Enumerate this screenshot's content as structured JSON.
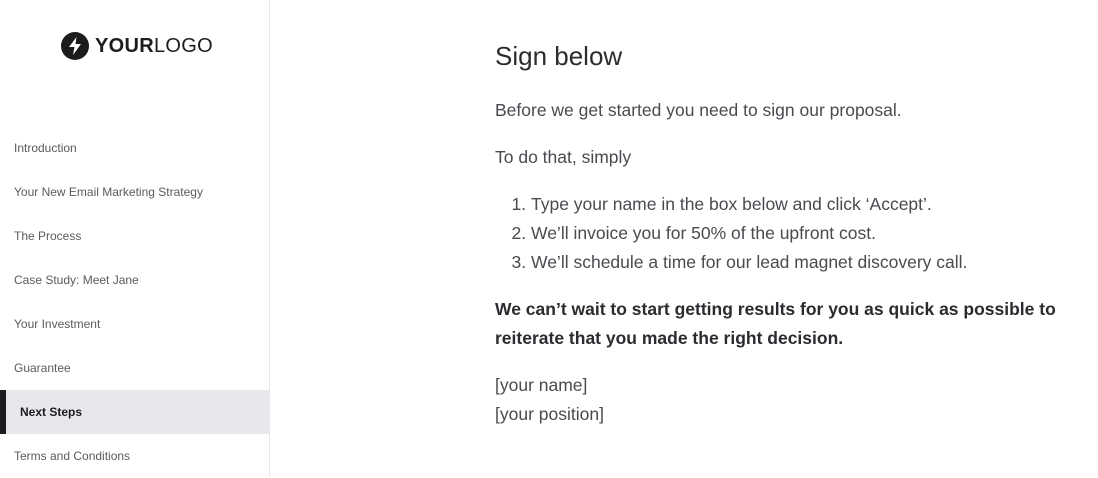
{
  "logo": {
    "icon": "lightning-bolt-icon",
    "text_bold": "YOUR",
    "text_light": "LOGO"
  },
  "sidebar": {
    "items": [
      {
        "label": "Introduction",
        "active": false
      },
      {
        "label": "Your New Email Marketing Strategy",
        "active": false
      },
      {
        "label": "The Process",
        "active": false
      },
      {
        "label": "Case Study: Meet Jane",
        "active": false
      },
      {
        "label": "Your Investment",
        "active": false
      },
      {
        "label": "Guarantee",
        "active": false
      },
      {
        "label": "Next Steps",
        "active": true
      },
      {
        "label": "Terms and Conditions",
        "active": false
      }
    ]
  },
  "main": {
    "heading": "Sign below",
    "intro": "Before we get started you need to sign our proposal.",
    "lead": "To do that, simply",
    "steps": [
      "Type your name in the box below and click ‘Accept’.",
      "We’ll invoice you for 50% of the upfront cost.",
      "We’ll schedule a time for our lead magnet discovery call."
    ],
    "closing": "We can’t wait to start getting results for you as quick as possible to reiterate that you made the right decision.",
    "signature_name": "[your name]",
    "signature_position": "[your position]"
  },
  "colors": {
    "active_bg": "#e6e8ee",
    "active_bar": "#1c1c1f",
    "text": "#4a4a50"
  }
}
